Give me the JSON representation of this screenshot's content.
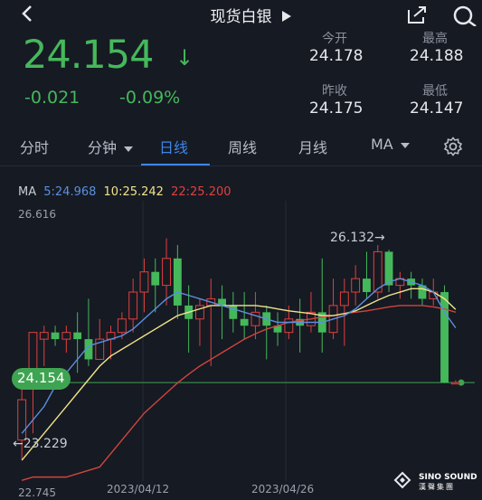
{
  "header": {
    "title": "现货白银"
  },
  "quote": {
    "price": "24.154",
    "arrow": "↓",
    "change": "-0.021",
    "change_pct": "-0.09%"
  },
  "stats": {
    "open_label": "今开",
    "open_value": "24.178",
    "high_label": "最高",
    "high_value": "24.188",
    "prev_label": "昨收",
    "prev_value": "24.175",
    "low_label": "最低",
    "low_value": "24.147"
  },
  "tabs": [
    {
      "label": "分时"
    },
    {
      "label": "分钟"
    },
    {
      "label": "日线"
    },
    {
      "label": "周线"
    },
    {
      "label": "月线"
    },
    {
      "label": "MA"
    }
  ],
  "ma": {
    "label": "MA",
    "ma5": "5:24.968",
    "ma10": "10:25.242",
    "ma22": "22:25.200"
  },
  "colors": {
    "up": "#e0403f",
    "down": "#45b85b",
    "ma5": "#5b8fe0",
    "ma10": "#f0e38a",
    "ma22": "#d0453d",
    "accent": "#3e86e8"
  },
  "chart_labels": {
    "y_top": "26.616",
    "y_bottom": "22.745",
    "x1": "2023/04/12",
    "x2": "2023/04/26",
    "current": "24.154",
    "high_marker": "26.132→",
    "low_marker": "←23.229"
  },
  "logo": {
    "title": "SINO SOUND",
    "subtitle": "漢聲集團"
  },
  "chart_data": {
    "type": "candlestick",
    "y_range": [
      22.745,
      26.616
    ],
    "candles": [
      [
        23.3,
        23.9,
        23.0,
        24.2
      ],
      [
        24.1,
        24.9,
        23.4,
        24.9
      ],
      [
        24.8,
        24.9,
        24.4,
        25.0
      ],
      [
        24.9,
        24.8,
        24.7,
        25.0
      ],
      [
        24.8,
        24.9,
        24.6,
        25.0
      ],
      [
        24.9,
        24.8,
        24.3,
        25.2
      ],
      [
        24.8,
        24.5,
        24.4,
        25.4
      ],
      [
        24.5,
        24.8,
        24.5,
        25.1
      ],
      [
        24.8,
        24.9,
        24.5,
        25.0
      ],
      [
        24.9,
        25.1,
        24.8,
        25.2
      ],
      [
        25.1,
        25.5,
        24.9,
        25.7
      ],
      [
        25.5,
        25.8,
        25.2,
        26.0
      ],
      [
        25.8,
        25.6,
        25.2,
        26.0
      ],
      [
        25.6,
        26.0,
        25.3,
        26.3
      ],
      [
        26.0,
        25.3,
        25.1,
        26.2
      ],
      [
        25.3,
        25.1,
        24.6,
        25.6
      ],
      [
        25.1,
        25.3,
        24.7,
        25.4
      ],
      [
        25.3,
        25.4,
        24.4,
        25.7
      ],
      [
        25.4,
        25.3,
        24.8,
        25.6
      ],
      [
        25.3,
        25.1,
        24.9,
        25.5
      ],
      [
        25.1,
        25.0,
        24.8,
        25.5
      ],
      [
        25.0,
        25.2,
        24.8,
        25.5
      ],
      [
        25.2,
        25.0,
        24.5,
        25.3
      ],
      [
        25.0,
        24.9,
        24.7,
        25.2
      ],
      [
        24.9,
        25.1,
        24.8,
        25.3
      ],
      [
        25.1,
        25.0,
        24.6,
        25.4
      ],
      [
        25.0,
        25.2,
        24.9,
        25.5
      ],
      [
        25.2,
        24.9,
        24.6,
        26.0
      ],
      [
        24.9,
        25.3,
        24.8,
        25.7
      ],
      [
        25.3,
        25.5,
        24.7,
        25.7
      ],
      [
        25.5,
        25.7,
        25.3,
        25.9
      ],
      [
        25.7,
        25.5,
        25.4,
        26.1
      ],
      [
        25.5,
        26.1,
        25.4,
        26.2
      ],
      [
        26.1,
        25.6,
        25.5,
        26.13
      ],
      [
        25.6,
        25.7,
        25.4,
        25.8
      ],
      [
        25.7,
        25.6,
        25.4,
        25.8
      ],
      [
        25.6,
        25.4,
        25.3,
        25.7
      ],
      [
        25.4,
        25.5,
        25.3,
        25.7
      ],
      [
        25.5,
        24.154,
        24.147,
        25.6
      ],
      [
        24.15,
        24.154,
        24.147,
        24.188
      ]
    ],
    "ma5": [
      23.4,
      23.6,
      23.8,
      24.1,
      24.3,
      24.5,
      24.7,
      24.75,
      24.8,
      24.85,
      24.95,
      25.1,
      25.25,
      25.4,
      25.5,
      25.45,
      25.4,
      25.35,
      25.3,
      25.25,
      25.2,
      25.15,
      25.1,
      25.05,
      25.05,
      25.05,
      25.05,
      25.05,
      25.1,
      25.15,
      25.25,
      25.4,
      25.55,
      25.65,
      25.7,
      25.65,
      25.6,
      25.5,
      25.2,
      24.968
    ],
    "ma10": [
      23.0,
      23.2,
      23.4,
      23.6,
      23.8,
      24.0,
      24.2,
      24.4,
      24.55,
      24.65,
      24.75,
      24.85,
      24.95,
      25.05,
      25.15,
      25.2,
      25.25,
      25.3,
      25.3,
      25.3,
      25.3,
      25.3,
      25.28,
      25.25,
      25.22,
      25.2,
      25.18,
      25.15,
      25.15,
      25.18,
      25.22,
      25.3,
      25.38,
      25.45,
      25.5,
      25.55,
      25.55,
      25.5,
      25.4,
      25.242
    ],
    "ma22": [
      22.7,
      22.75,
      22.75,
      22.75,
      22.75,
      22.8,
      22.85,
      22.9,
      23.1,
      23.3,
      23.5,
      23.7,
      23.85,
      24.0,
      24.15,
      24.28,
      24.4,
      24.5,
      24.6,
      24.7,
      24.8,
      24.88,
      24.95,
      25.0,
      25.05,
      25.08,
      25.1,
      25.13,
      25.15,
      25.18,
      25.2,
      25.22,
      25.25,
      25.28,
      25.3,
      25.3,
      25.3,
      25.28,
      25.25,
      25.2
    ]
  }
}
